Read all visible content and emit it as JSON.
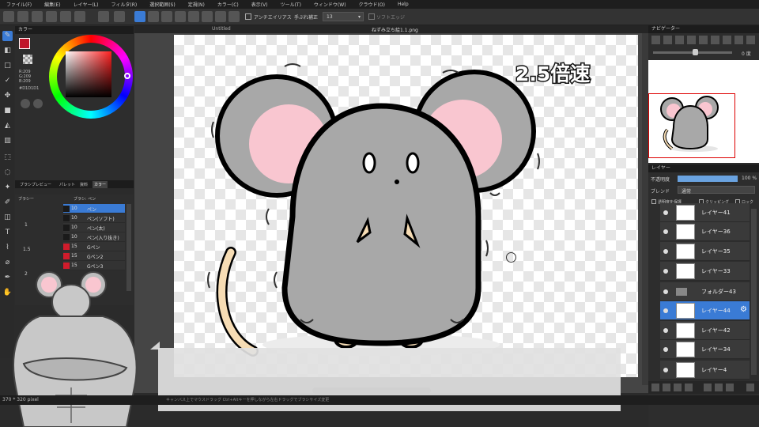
{
  "menu": [
    "ファイル(F)",
    "編集(E)",
    "レイヤー(L)",
    "フィルタ(R)",
    "選択範囲(S)",
    "定規(N)",
    "カラー(C)",
    "表示(V)",
    "ツール(T)",
    "ウィンドウ(W)",
    "クラウド(O)",
    "Help"
  ],
  "toolbar": {
    "antialias_label": "アンチエイリアス",
    "stabilizer_label": "手ぶれ補正",
    "stabilizer_value": "13",
    "soft_edge_label": "ソフトエッジ"
  },
  "color_panel": {
    "title": "カラー",
    "r": "R:209",
    "g": "G:209",
    "b": "B:209",
    "hex": "#D1D1D1"
  },
  "brush_panel": {
    "tabs": [
      "ブラシプレビュー",
      "パレット",
      "資料",
      "カラー"
    ],
    "size_header": "ブラシー",
    "list_header": "ブラシ: ペン",
    "sizes": [
      "1",
      "1.5",
      "2"
    ],
    "brushes": [
      {
        "size": "10",
        "name": "ペン",
        "color": "#1a1a1a",
        "selected": true
      },
      {
        "size": "10",
        "name": "ペン(ソフト)",
        "color": "#1a1a1a",
        "selected": false
      },
      {
        "size": "10",
        "name": "ペン(太)",
        "color": "#1a1a1a",
        "selected": false
      },
      {
        "size": "10",
        "name": "ペン(入り抜き)",
        "color": "#1a1a1a",
        "selected": false
      },
      {
        "size": "15",
        "name": "Gペン",
        "color": "#d01c2c",
        "selected": false
      },
      {
        "size": "15",
        "name": "Gペン2",
        "color": "#d01c2c",
        "selected": false
      },
      {
        "size": "15",
        "name": "Gペン3",
        "color": "#d01c2c",
        "selected": false
      }
    ]
  },
  "canvas": {
    "tab_left": "Untitled",
    "tab_right": "ねずみ立ち絵1.1.png",
    "overlay_text": "2.5倍速"
  },
  "navigator": {
    "title": "ナビゲーター",
    "angle": "0 度"
  },
  "layer_panel": {
    "title": "レイヤー",
    "opacity_label": "不透明度",
    "opacity_value": "100 %",
    "blend_label": "ブレンド",
    "blend_value": "通常",
    "protect_label": "透明度を保護",
    "clipping_label": "クリッピング",
    "lock_label": "ロック",
    "layers": [
      {
        "name": "レイヤー41",
        "selected": false
      },
      {
        "name": "レイヤー36",
        "selected": false
      },
      {
        "name": "レイヤー35",
        "selected": false
      },
      {
        "name": "レイヤー33",
        "selected": false
      },
      {
        "name": "フォルダー43",
        "selected": false
      },
      {
        "name": "レイヤー44",
        "selected": true
      },
      {
        "name": "レイヤー42",
        "selected": false
      },
      {
        "name": "レイヤー34",
        "selected": false
      },
      {
        "name": "レイヤー4",
        "selected": false
      }
    ]
  },
  "statusbar": {
    "size": "370 * 320 pixel",
    "hint": "キャンバス上でマウスドラッグ Ctrl+Altキーを押しながら左右ドラッグでブラシサイズ変更"
  }
}
